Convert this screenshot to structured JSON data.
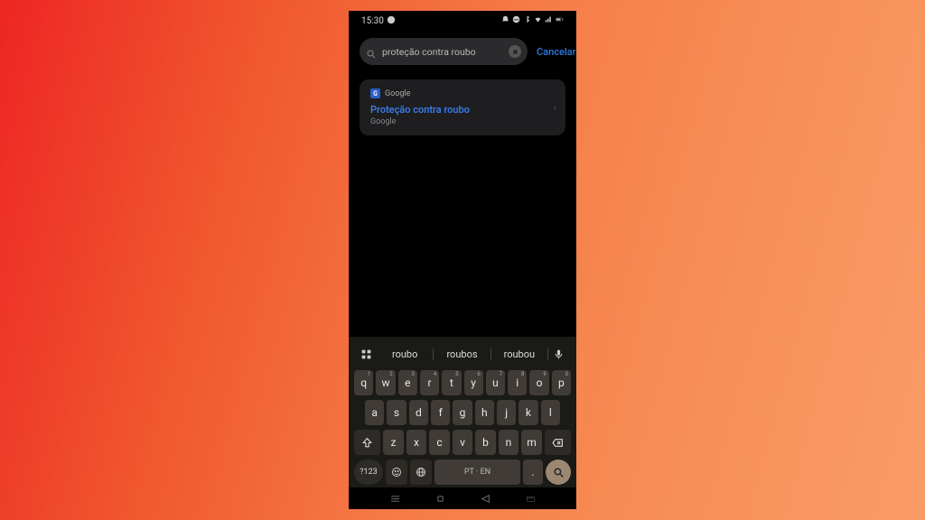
{
  "statusbar": {
    "time": "15:30"
  },
  "search": {
    "value": "proteção contra roubo",
    "cancel": "Cancelar"
  },
  "result": {
    "source": "Google",
    "title": "Proteção contra roubo",
    "subtitle": "Google"
  },
  "suggestions": [
    "roubo",
    "roubos",
    "roubou"
  ],
  "keyboard": {
    "row1": [
      {
        "k": "q",
        "s": "1"
      },
      {
        "k": "w",
        "s": "2"
      },
      {
        "k": "e",
        "s": "3"
      },
      {
        "k": "r",
        "s": "4"
      },
      {
        "k": "t",
        "s": "5"
      },
      {
        "k": "y",
        "s": "6"
      },
      {
        "k": "u",
        "s": "7"
      },
      {
        "k": "i",
        "s": "8"
      },
      {
        "k": "o",
        "s": "9"
      },
      {
        "k": "p",
        "s": "0"
      }
    ],
    "row2": [
      "a",
      "s",
      "d",
      "f",
      "g",
      "h",
      "j",
      "k",
      "l"
    ],
    "row3": [
      "z",
      "x",
      "c",
      "v",
      "b",
      "n",
      "m"
    ],
    "numkey": "?123",
    "space": "PT · EN",
    "dot": "."
  }
}
